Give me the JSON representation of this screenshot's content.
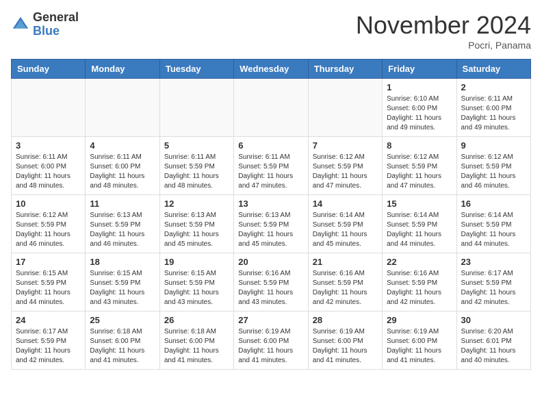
{
  "header": {
    "logo_general": "General",
    "logo_blue": "Blue",
    "month_title": "November 2024",
    "location": "Pocri, Panama"
  },
  "weekdays": [
    "Sunday",
    "Monday",
    "Tuesday",
    "Wednesday",
    "Thursday",
    "Friday",
    "Saturday"
  ],
  "weeks": [
    [
      {
        "day": "",
        "info": ""
      },
      {
        "day": "",
        "info": ""
      },
      {
        "day": "",
        "info": ""
      },
      {
        "day": "",
        "info": ""
      },
      {
        "day": "",
        "info": ""
      },
      {
        "day": "1",
        "info": "Sunrise: 6:10 AM\nSunset: 6:00 PM\nDaylight: 11 hours\nand 49 minutes."
      },
      {
        "day": "2",
        "info": "Sunrise: 6:11 AM\nSunset: 6:00 PM\nDaylight: 11 hours\nand 49 minutes."
      }
    ],
    [
      {
        "day": "3",
        "info": "Sunrise: 6:11 AM\nSunset: 6:00 PM\nDaylight: 11 hours\nand 48 minutes."
      },
      {
        "day": "4",
        "info": "Sunrise: 6:11 AM\nSunset: 6:00 PM\nDaylight: 11 hours\nand 48 minutes."
      },
      {
        "day": "5",
        "info": "Sunrise: 6:11 AM\nSunset: 5:59 PM\nDaylight: 11 hours\nand 48 minutes."
      },
      {
        "day": "6",
        "info": "Sunrise: 6:11 AM\nSunset: 5:59 PM\nDaylight: 11 hours\nand 47 minutes."
      },
      {
        "day": "7",
        "info": "Sunrise: 6:12 AM\nSunset: 5:59 PM\nDaylight: 11 hours\nand 47 minutes."
      },
      {
        "day": "8",
        "info": "Sunrise: 6:12 AM\nSunset: 5:59 PM\nDaylight: 11 hours\nand 47 minutes."
      },
      {
        "day": "9",
        "info": "Sunrise: 6:12 AM\nSunset: 5:59 PM\nDaylight: 11 hours\nand 46 minutes."
      }
    ],
    [
      {
        "day": "10",
        "info": "Sunrise: 6:12 AM\nSunset: 5:59 PM\nDaylight: 11 hours\nand 46 minutes."
      },
      {
        "day": "11",
        "info": "Sunrise: 6:13 AM\nSunset: 5:59 PM\nDaylight: 11 hours\nand 46 minutes."
      },
      {
        "day": "12",
        "info": "Sunrise: 6:13 AM\nSunset: 5:59 PM\nDaylight: 11 hours\nand 45 minutes."
      },
      {
        "day": "13",
        "info": "Sunrise: 6:13 AM\nSunset: 5:59 PM\nDaylight: 11 hours\nand 45 minutes."
      },
      {
        "day": "14",
        "info": "Sunrise: 6:14 AM\nSunset: 5:59 PM\nDaylight: 11 hours\nand 45 minutes."
      },
      {
        "day": "15",
        "info": "Sunrise: 6:14 AM\nSunset: 5:59 PM\nDaylight: 11 hours\nand 44 minutes."
      },
      {
        "day": "16",
        "info": "Sunrise: 6:14 AM\nSunset: 5:59 PM\nDaylight: 11 hours\nand 44 minutes."
      }
    ],
    [
      {
        "day": "17",
        "info": "Sunrise: 6:15 AM\nSunset: 5:59 PM\nDaylight: 11 hours\nand 44 minutes."
      },
      {
        "day": "18",
        "info": "Sunrise: 6:15 AM\nSunset: 5:59 PM\nDaylight: 11 hours\nand 43 minutes."
      },
      {
        "day": "19",
        "info": "Sunrise: 6:15 AM\nSunset: 5:59 PM\nDaylight: 11 hours\nand 43 minutes."
      },
      {
        "day": "20",
        "info": "Sunrise: 6:16 AM\nSunset: 5:59 PM\nDaylight: 11 hours\nand 43 minutes."
      },
      {
        "day": "21",
        "info": "Sunrise: 6:16 AM\nSunset: 5:59 PM\nDaylight: 11 hours\nand 42 minutes."
      },
      {
        "day": "22",
        "info": "Sunrise: 6:16 AM\nSunset: 5:59 PM\nDaylight: 11 hours\nand 42 minutes."
      },
      {
        "day": "23",
        "info": "Sunrise: 6:17 AM\nSunset: 5:59 PM\nDaylight: 11 hours\nand 42 minutes."
      }
    ],
    [
      {
        "day": "24",
        "info": "Sunrise: 6:17 AM\nSunset: 5:59 PM\nDaylight: 11 hours\nand 42 minutes."
      },
      {
        "day": "25",
        "info": "Sunrise: 6:18 AM\nSunset: 6:00 PM\nDaylight: 11 hours\nand 41 minutes."
      },
      {
        "day": "26",
        "info": "Sunrise: 6:18 AM\nSunset: 6:00 PM\nDaylight: 11 hours\nand 41 minutes."
      },
      {
        "day": "27",
        "info": "Sunrise: 6:19 AM\nSunset: 6:00 PM\nDaylight: 11 hours\nand 41 minutes."
      },
      {
        "day": "28",
        "info": "Sunrise: 6:19 AM\nSunset: 6:00 PM\nDaylight: 11 hours\nand 41 minutes."
      },
      {
        "day": "29",
        "info": "Sunrise: 6:19 AM\nSunset: 6:00 PM\nDaylight: 11 hours\nand 41 minutes."
      },
      {
        "day": "30",
        "info": "Sunrise: 6:20 AM\nSunset: 6:01 PM\nDaylight: 11 hours\nand 40 minutes."
      }
    ]
  ]
}
